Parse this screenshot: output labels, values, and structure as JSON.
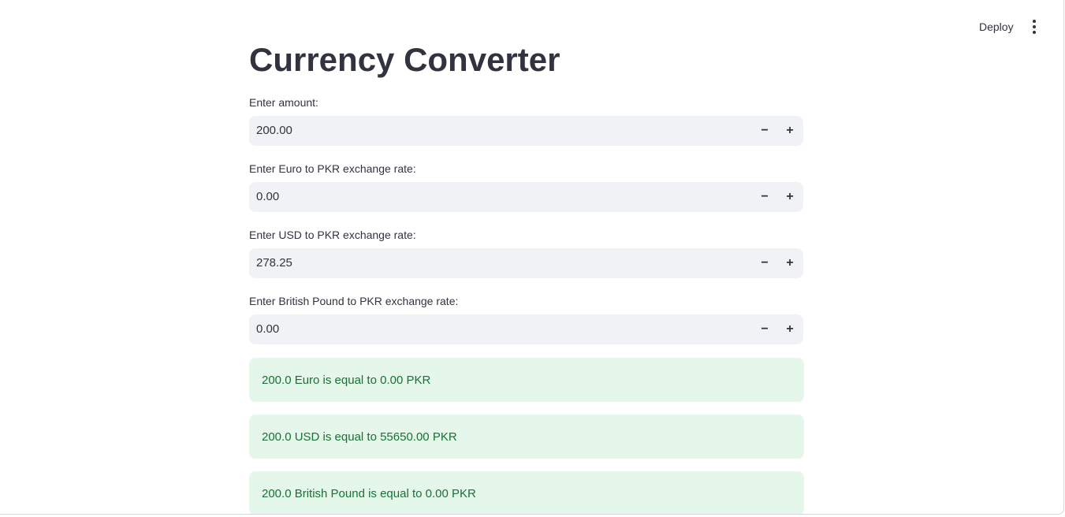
{
  "header": {
    "deploy_label": "Deploy",
    "menu_icon": "kebab-menu-icon"
  },
  "main": {
    "title": "Currency Converter",
    "fields": [
      {
        "label": "Enter amount:",
        "value": "200.00",
        "minus": "−",
        "plus": "+"
      },
      {
        "label": "Enter Euro to PKR exchange rate:",
        "value": "0.00",
        "minus": "−",
        "plus": "+"
      },
      {
        "label": "Enter USD to PKR exchange rate:",
        "value": "278.25",
        "minus": "−",
        "plus": "+"
      },
      {
        "label": "Enter British Pound to PKR exchange rate:",
        "value": "0.00",
        "minus": "−",
        "plus": "+"
      }
    ],
    "results": [
      "200.0 Euro is equal to 0.00 PKR",
      "200.0 USD is equal to 55650.00 PKR",
      "200.0 British Pound is equal to 0.00 PKR"
    ]
  },
  "colors": {
    "text": "#31333f",
    "input_bg": "#f0f2f6",
    "success_bg": "#e5f6ea",
    "success_text": "#177233"
  }
}
